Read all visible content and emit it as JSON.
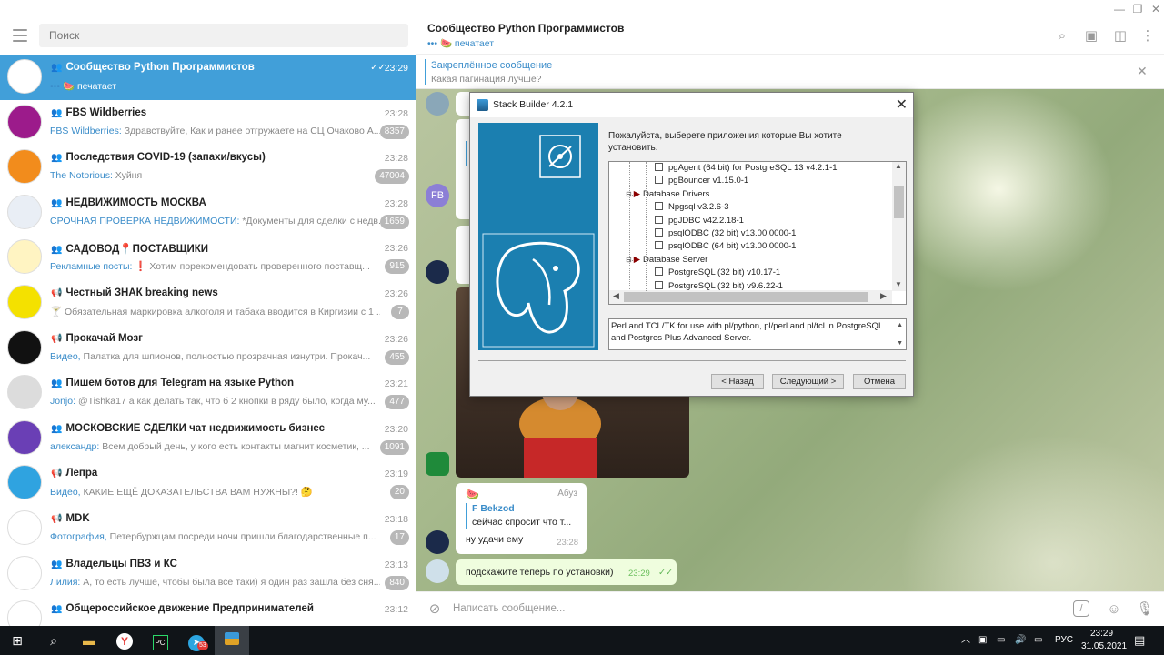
{
  "window": {
    "min": "—",
    "restore": "❐",
    "close": "✕"
  },
  "search": {
    "placeholder": "Поиск"
  },
  "chats": [
    {
      "name": "Сообщество Python Программистов",
      "time": "23:29",
      "prefix": "••• 🍉 ",
      "preview": "печатает",
      "badge": "",
      "active": true,
      "read": "✓✓",
      "type": "group",
      "av_bg": "#ffffff"
    },
    {
      "name": "FBS Wildberries",
      "time": "23:28",
      "prefix": "FBS Wildberries: ",
      "preview": "Здравствуйте, Как и ранее отгружаете на СЦ Очаково  А...",
      "badge": "8357",
      "type": "group",
      "av_bg": "#9c1b8b"
    },
    {
      "name": "Последствия COVID-19 (запахи/вкусы)",
      "time": "23:28",
      "prefix": "The Notorious: ",
      "preview": "Хуйня",
      "badge": "47004",
      "type": "group",
      "av_bg": "#f28c1c"
    },
    {
      "name": "НЕДВИЖИМОСТЬ МОСКВА",
      "time": "23:28",
      "prefix": "СРОЧНАЯ ПРОВЕРКА НЕДВИЖИМОСТИ: ",
      "preview": "*Документы для сделки с недв...",
      "badge": "1659",
      "type": "group",
      "av_bg": "#e9eef5"
    },
    {
      "name": "САДОВОД📍ПОСТАВЩИКИ",
      "time": "23:26",
      "prefix": "Рекламные посты: ",
      "preview": "❗ Хотим порекомендовать проверенного поставщ...",
      "badge": "915",
      "type": "group",
      "av_bg": "#fff4c2"
    },
    {
      "name": "Честный ЗНАК breaking news",
      "time": "23:26",
      "prefix": "🍸 ",
      "preview": "Обязательная маркировка алкоголя и табака вводится в Киргизии с 1 ...",
      "badge": "7",
      "type": "channel",
      "av_bg": "#f4e100"
    },
    {
      "name": "Прокачай Мозг",
      "time": "23:26",
      "prefix": "Видео, ",
      "preview": "Палатка для шпионов, полностью прозрачная изнутри.  Прокач...",
      "badge": "455",
      "type": "channel",
      "av_bg": "#111111"
    },
    {
      "name": "Пишем ботов для Telegram на языке Python",
      "time": "23:21",
      "prefix": "Jonjo: ",
      "preview": "@Tishka17  а как делать так, что б 2 кнопки в ряду было, когда му...",
      "badge": "477",
      "type": "group",
      "av_bg": "#dcdcdc"
    },
    {
      "name": "МОСКОВСКИЕ СДЕЛКИ чат недвижимость бизнес",
      "time": "23:20",
      "prefix": "александр: ",
      "preview": "Всем добрый день, у кого есть контакты магнит косметик, ...",
      "badge": "1091",
      "type": "group",
      "av_bg": "#6a3fb5"
    },
    {
      "name": "Лепра",
      "time": "23:19",
      "prefix": "Видео, ",
      "preview": "КАКИЕ ЕЩЁ ДОКАЗАТЕЛЬСТВА ВАМ НУЖНЫ?! 🤔",
      "badge": "20",
      "type": "channel",
      "av_bg": "#2fa3e0"
    },
    {
      "name": "MDK",
      "time": "23:18",
      "prefix": "Фотография, ",
      "preview": "Петербуржцам посреди ночи пришли благодарственные п...",
      "badge": "17",
      "type": "channel",
      "av_bg": "#ffffff"
    },
    {
      "name": "Владельцы ПВЗ и КС",
      "time": "23:13",
      "prefix": "Лилия: ",
      "preview": "А, то есть лучше, чтобы была все таки) я один раз зашла без сня...",
      "badge": "840",
      "type": "group",
      "av_bg": "#ffffff"
    },
    {
      "name": "Общероссийское движение Предпринимателей",
      "time": "23:12",
      "prefix": "",
      "preview": "",
      "badge": "",
      "type": "group",
      "av_bg": "#ffffff"
    }
  ],
  "header": {
    "title": "Сообщество Python Программистов",
    "status": "••• 🍉 печатает"
  },
  "pinned": {
    "title": "Закреплённое сообщение",
    "text": "Какая пагинация лучше?"
  },
  "messages": {
    "avatar_fb": "FB",
    "reply_author": "Абуз",
    "quote_name": "F Bekzod",
    "quote_text": "сейчас спросит что т...",
    "reply_text": "ну удачи ему",
    "reply_time": "23:28",
    "mine_text": "подскажите теперь по установки)",
    "mine_time": "23:29",
    "mine_ticks": "✓✓"
  },
  "composer": {
    "placeholder": "Написать сообщение..."
  },
  "dialog": {
    "title": "Stack Builder 4.2.1",
    "prompt": "Пожалуйста, выберете приложения которые Вы хотите установить.",
    "tree": [
      {
        "label": "pgAgent (64 bit) for PostgreSQL 13 v4.2.1-1",
        "kind": "item"
      },
      {
        "label": "pgBouncer v1.15.0-1",
        "kind": "item"
      },
      {
        "label": "Database Drivers",
        "kind": "category"
      },
      {
        "label": "Npgsql v3.2.6-3",
        "kind": "item"
      },
      {
        "label": "pgJDBC v42.2.18-1",
        "kind": "item"
      },
      {
        "label": "psqlODBC (32 bit) v13.00.0000-1",
        "kind": "item"
      },
      {
        "label": "psqlODBC (64 bit) v13.00.0000-1",
        "kind": "item"
      },
      {
        "label": "Database Server",
        "kind": "category"
      },
      {
        "label": "PostgreSQL (32 bit) v10.17-1",
        "kind": "item"
      },
      {
        "label": "PostgreSQL (32 bit) v9.6.22-1",
        "kind": "item"
      }
    ],
    "description": "Perl and TCL/TK for use with pl/python, pl/perl and pl/tcl in PostgreSQL and Postgres Plus Advanced Server.",
    "back": "< Назад",
    "next": "Следующий >",
    "cancel": "Отмена"
  },
  "taskbar": {
    "language": "РУС",
    "time": "23:29",
    "date": "31.05.2021",
    "telegram_badge": "53"
  }
}
